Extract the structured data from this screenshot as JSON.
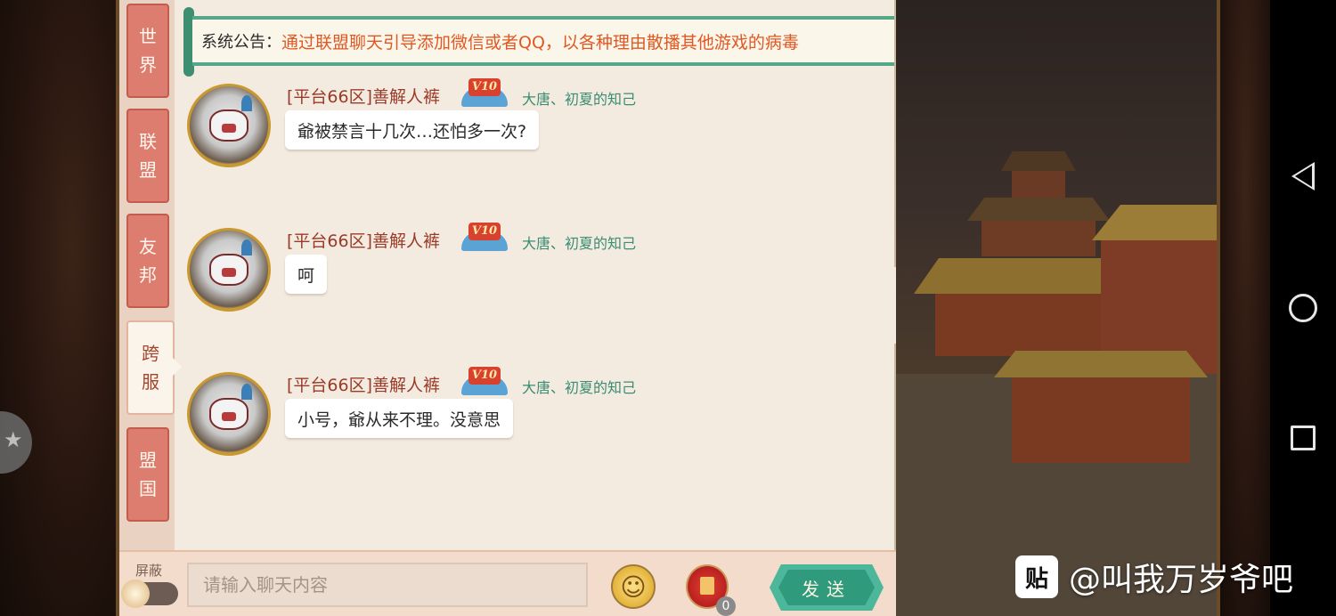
{
  "announcement": {
    "label": "系统公告：",
    "text": "通过联盟聊天引导添加微信或者QQ，以各种理由散播其他游戏的病毒"
  },
  "tabs": [
    {
      "line1": "世",
      "line2": "界",
      "active": false
    },
    {
      "line1": "联",
      "line2": "盟",
      "active": false
    },
    {
      "line1": "友",
      "line2": "邦",
      "active": false
    },
    {
      "line1": "跨",
      "line2": "服",
      "active": true
    },
    {
      "line1": "盟",
      "line2": "国",
      "active": false
    }
  ],
  "messages": [
    {
      "sender": "[平台66区]善解人裤",
      "vip": "V10",
      "faction": "大唐、初夏的知己",
      "text": "爺被禁言十几次…还怕多一次?"
    },
    {
      "sender": "[平台66区]善解人裤",
      "vip": "V10",
      "faction": "大唐、初夏的知己",
      "text": "呵"
    },
    {
      "sender": "[平台66区]善解人裤",
      "vip": "V10",
      "faction": "大唐、初夏的知己",
      "text": "小号，爺从来不理。没意思"
    }
  ],
  "input_bar": {
    "mute_label": "屏蔽",
    "placeholder": "请输入聊天内容",
    "emoji_icon": "smiley-icon",
    "red_packet_count": "0",
    "send_label": "发送"
  },
  "collapse_icon": "chevron-left-icon",
  "watermark": {
    "logo": "贴",
    "text": "@叫我万岁爷吧"
  },
  "colors": {
    "tab_red": "#dd7d6f",
    "sender_red": "#9a3a28",
    "faction_green": "#3a8c73",
    "announcement_orange": "#e05822",
    "send_green": "#2f9a7c"
  }
}
